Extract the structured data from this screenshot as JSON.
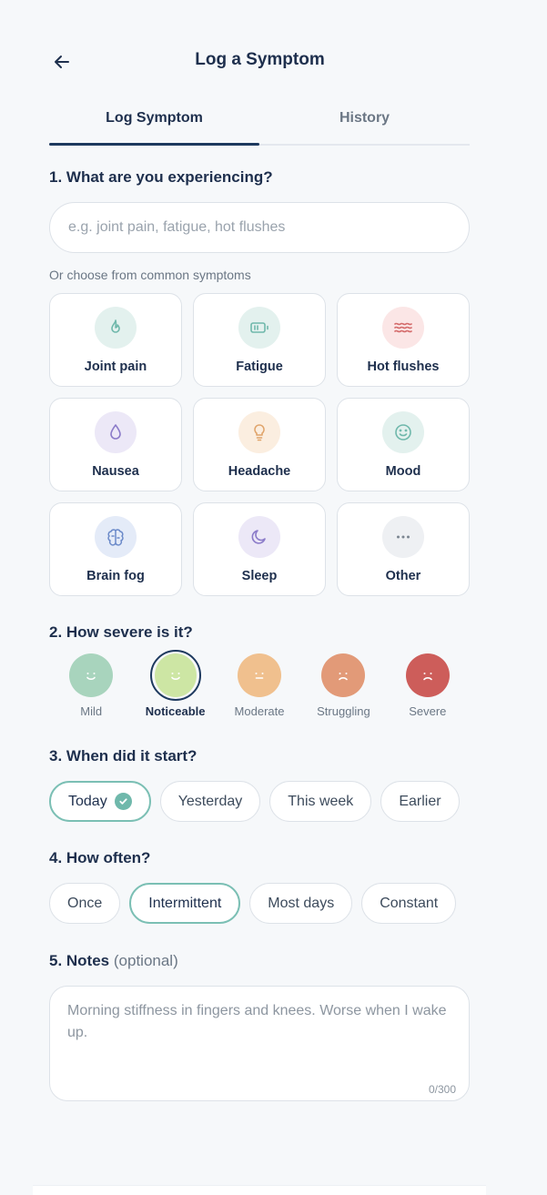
{
  "header": {
    "title": "Log a Symptom"
  },
  "tabs": [
    {
      "label": "Log Symptom",
      "active": true
    },
    {
      "label": "History",
      "active": false
    }
  ],
  "q1": {
    "title": "1. What are you experiencing?",
    "placeholder": "e.g. joint pain, fatigue, hot flushes",
    "hint": "Or choose from common symptoms",
    "symptoms": [
      {
        "label": "Joint pain",
        "icon": "flame-icon",
        "bg": "#e3f1ee",
        "fg": "#6fb8ab"
      },
      {
        "label": "Fatigue",
        "icon": "battery-icon",
        "bg": "#e3f1ee",
        "fg": "#6fb8ab"
      },
      {
        "label": "Hot flushes",
        "icon": "waves-icon",
        "bg": "#fbe6e6",
        "fg": "#d46b6b"
      },
      {
        "label": "Nausea",
        "icon": "droplet-icon",
        "bg": "#ece8f7",
        "fg": "#8b7bc9"
      },
      {
        "label": "Headache",
        "icon": "lightbulb-icon",
        "bg": "#fbeee0",
        "fg": "#e0a46a"
      },
      {
        "label": "Mood",
        "icon": "smile-icon",
        "bg": "#e3f1ee",
        "fg": "#6fb8ab"
      },
      {
        "label": "Brain fog",
        "icon": "brain-icon",
        "bg": "#e4ebf8",
        "fg": "#6b8ac9"
      },
      {
        "label": "Sleep",
        "icon": "moon-icon",
        "bg": "#ece8f7",
        "fg": "#8b7bc9"
      },
      {
        "label": "Other",
        "icon": "ellipsis-icon",
        "bg": "#eef0f3",
        "fg": "#7b8590"
      }
    ]
  },
  "q2": {
    "title": "2. How severe is it?",
    "levels": [
      {
        "label": "Mild",
        "color": "#a8d4bd",
        "mouth": "smile",
        "selected": false
      },
      {
        "label": "Noticeable",
        "color": "#cde6a4",
        "mouth": "smile",
        "selected": true
      },
      {
        "label": "Moderate",
        "color": "#f0c08e",
        "mouth": "flat",
        "selected": false
      },
      {
        "label": "Struggling",
        "color": "#e29a78",
        "mouth": "frown",
        "selected": false
      },
      {
        "label": "Severe",
        "color": "#cd5d5a",
        "mouth": "frown",
        "selected": false
      }
    ]
  },
  "q3": {
    "title": "3. When did it start?",
    "options": [
      {
        "label": "Today",
        "selected": true
      },
      {
        "label": "Yesterday",
        "selected": false
      },
      {
        "label": "This week",
        "selected": false
      },
      {
        "label": "Earlier",
        "selected": false
      }
    ]
  },
  "q4": {
    "title": "4. How often?",
    "options": [
      {
        "label": "Once",
        "selected": false
      },
      {
        "label": "Intermittent",
        "selected": true
      },
      {
        "label": "Most days",
        "selected": false
      },
      {
        "label": "Constant",
        "selected": false
      }
    ]
  },
  "q5": {
    "title": "5. Notes",
    "optional": "(optional)",
    "placeholder": "Morning stiffness in fingers and knees. Worse when I wake up.",
    "counter": "0/300"
  }
}
